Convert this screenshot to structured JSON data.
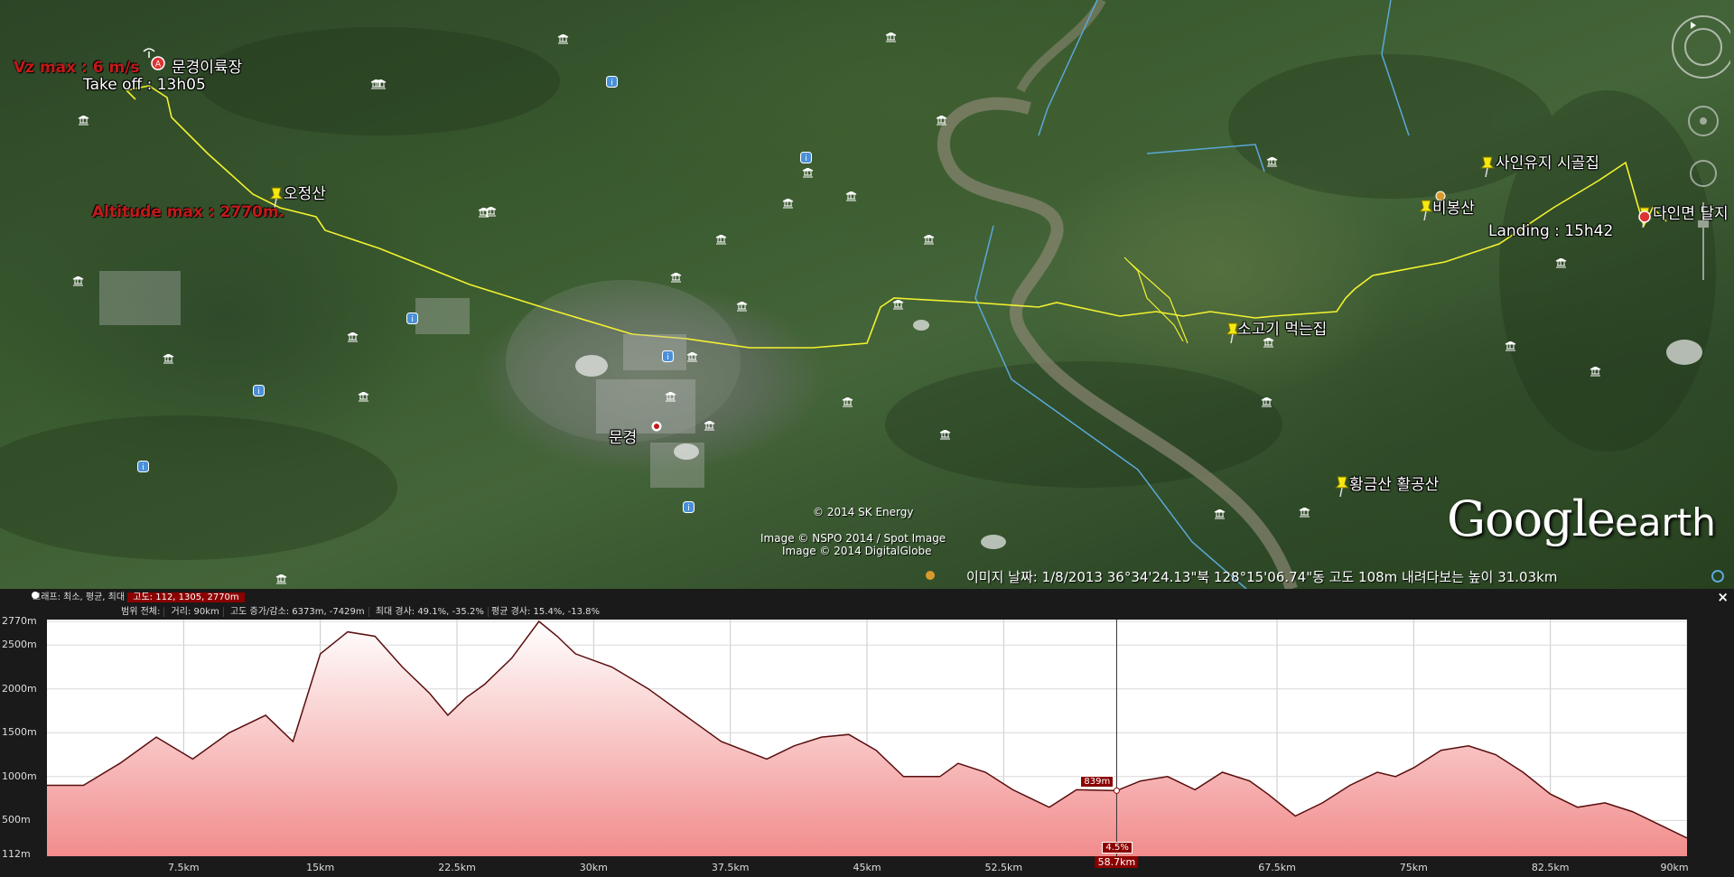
{
  "map": {
    "labels": {
      "vz_max": "Vz max : 6 m/s",
      "takeoff": "Take off : 13h05",
      "launch_site": "문경이륙장",
      "altitude_max": "Altitude max : 2770m.",
      "ojeongsan": "오정산",
      "mungyeong": "문경",
      "beef_restaurant": "소고기 먹는집",
      "hwanggeumsan": "황금산 활공산",
      "biboengsan": "비봉산",
      "sainyuji": "사인유지 시골집",
      "landing": "Landing : 15h42",
      "danin": "다인면 달지"
    },
    "attribution": {
      "line1": "© 2014 SK Energy",
      "line2": "Image © NSPO 2014 / Spot Image",
      "line3": "Image © 2014 DigitalGlobe"
    },
    "logo": {
      "google": "Google",
      "earth": "earth"
    },
    "status_bar": "이미지 날짜: 1/8/2013   36°34'24.13\"북 128°15'06.74\"동  고도  108m    내려다보는 높이  31.03km"
  },
  "profile": {
    "header": {
      "graph_label": "그래프: 최소, 평균, 최대",
      "graph_values": "고도: 112, 1305, 2770m",
      "range_label": "범위 전체:",
      "distance": "거리: 90km",
      "elev_gain": "고도 증가/감소: 6373m, -7429m",
      "max_slope": "최대 경사: 49.1%, -35.2%",
      "avg_slope": "평균 경사: 15.4%, -13.8%"
    },
    "close": "×",
    "cursor_elev": "839m",
    "cursor_slope": "4.5%",
    "cursor_dist": "58.7km"
  },
  "chart_data": {
    "type": "area",
    "xlabel": "",
    "ylabel": "",
    "x_unit": "km",
    "xlim": [
      0,
      90
    ],
    "ylim": [
      112,
      2770
    ],
    "y_ticks": [
      "2770m",
      "2500m",
      "2000m",
      "1500m",
      "1000m",
      "500m",
      "112m"
    ],
    "x_ticks": [
      "7.5km",
      "15km",
      "22.5km",
      "30km",
      "37.5km",
      "45km",
      "52.5km",
      "58.7km",
      "67.5km",
      "75km",
      "82.5km",
      "90km"
    ],
    "series": [
      {
        "x": [
          0,
          2,
          4,
          6,
          8,
          10,
          12,
          13.5,
          15,
          16.5,
          18,
          19.5,
          21,
          22,
          23,
          24,
          25.5,
          27,
          28,
          29,
          31,
          33,
          35,
          37,
          39.5,
          41,
          42.5,
          44,
          45.5,
          47,
          49,
          50,
          51.5,
          53,
          55,
          56.5,
          58.7,
          60,
          61.5,
          63,
          64.5,
          66,
          67,
          68.5,
          70,
          71.5,
          73,
          74,
          75,
          76.5,
          78,
          79.5,
          81,
          82.5,
          84,
          85.5,
          87,
          88.5,
          90
        ],
        "y": [
          900,
          900,
          1150,
          1450,
          1200,
          1500,
          1700,
          1400,
          2400,
          2650,
          2600,
          2250,
          1950,
          1700,
          1900,
          2050,
          2350,
          2770,
          2600,
          2400,
          2250,
          2000,
          1700,
          1400,
          1200,
          1350,
          1450,
          1480,
          1300,
          1000,
          1000,
          1150,
          1050,
          850,
          650,
          850,
          839,
          950,
          1000,
          850,
          1050,
          950,
          800,
          550,
          700,
          900,
          1050,
          1000,
          1100,
          1300,
          1350,
          1250,
          1050,
          800,
          650,
          700,
          600,
          450,
          300
        ]
      }
    ],
    "grid": true,
    "fill": "pink-gradient",
    "line_color": "#5a0d0d"
  }
}
